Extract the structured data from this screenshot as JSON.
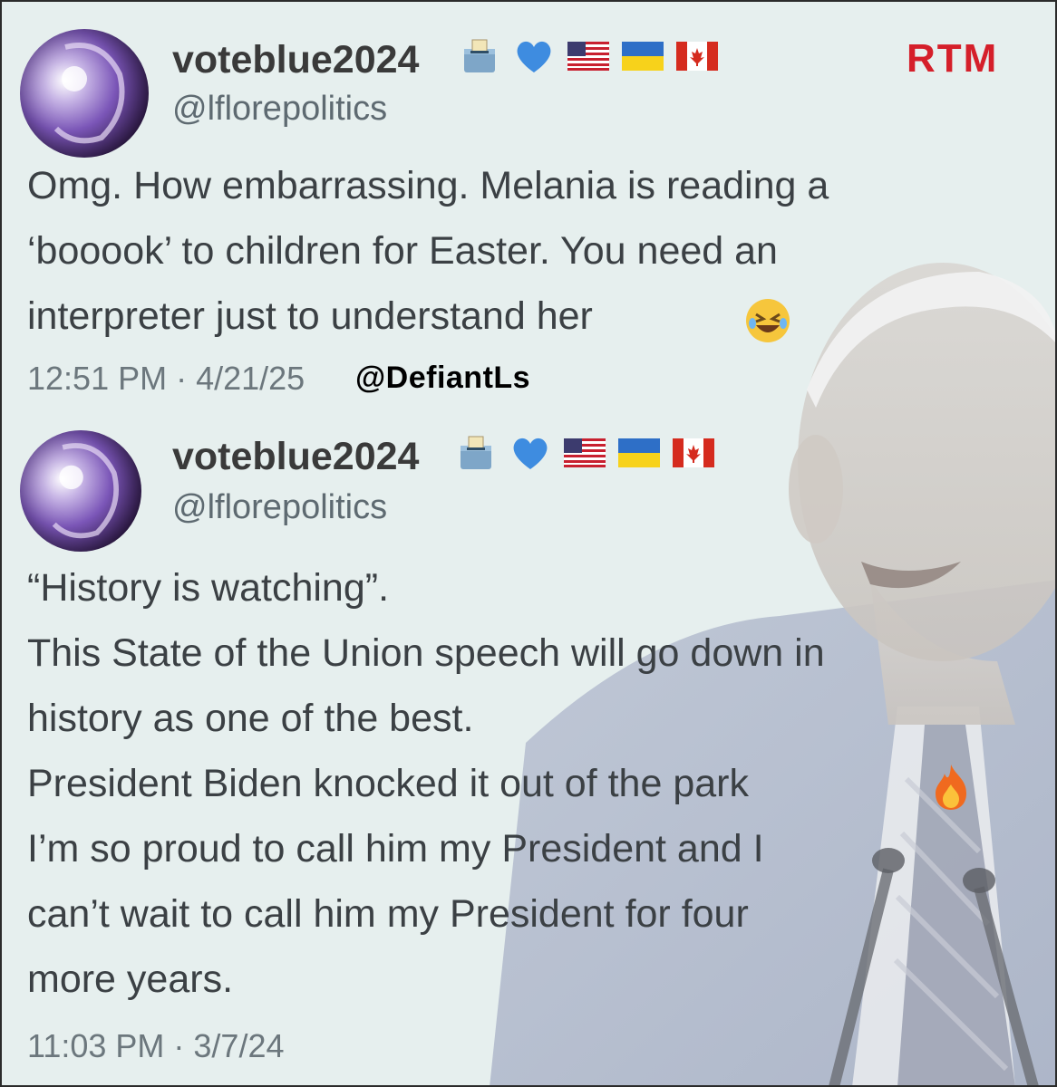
{
  "brand": {
    "rtm": "RTM",
    "color": "#d51f2a"
  },
  "watermark": "@DefiantLs",
  "tweets": [
    {
      "display_name": "voteblue2024",
      "handle": "@lflorepolitics",
      "name_emojis": [
        "ballot-box",
        "blue-heart",
        "us-flag",
        "ukraine-flag",
        "canada-flag"
      ],
      "lines": [
        "Omg. How embarrassing. Melania is reading a",
        "‘booook’ to children for Easter. You need an",
        "interpreter just to understand her"
      ],
      "trailing_emoji": "rolling-on-floor-laughing",
      "timestamp": "12:51 PM · 4/21/25"
    },
    {
      "display_name": "voteblue2024",
      "handle": "@lflorepolitics",
      "name_emojis": [
        "ballot-box",
        "blue-heart",
        "us-flag",
        "ukraine-flag",
        "canada-flag"
      ],
      "lines": [
        "“History is watching”.",
        "This State of the Union speech will go down in",
        "history as one of the best.",
        "President Biden knocked it out of the park",
        "I’m so proud to call him my President and I",
        "can’t wait to call him my President for four",
        "more years."
      ],
      "trailing_emoji": "fire",
      "timestamp": "11:03 PM · 3/7/24"
    }
  ]
}
